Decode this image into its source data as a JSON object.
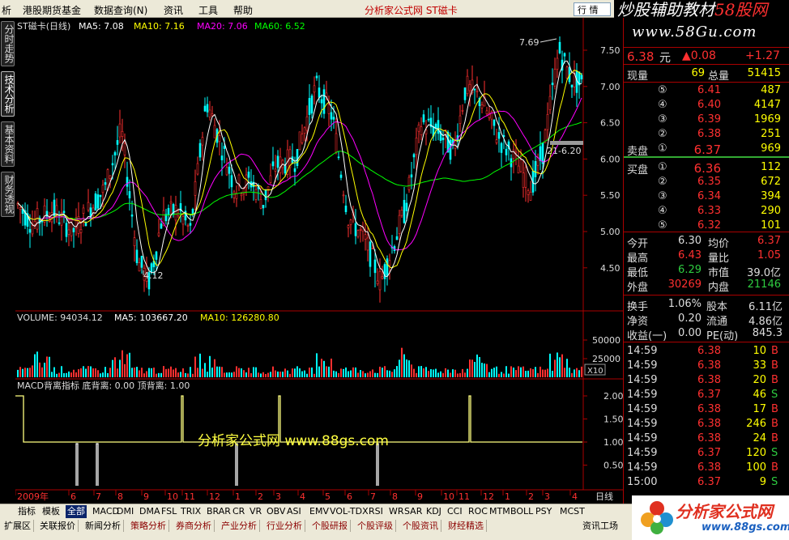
{
  "menu": {
    "items": [
      "析",
      "港股期货基金",
      "数据查询(N)",
      "资讯",
      "工具",
      "帮助"
    ],
    "window_title": "分析家公式网 ST磁卡",
    "right_button": "行 情",
    "top_logo_a": "炒股辅助教材",
    "top_logo_b": "58股网"
  },
  "left_tabs": [
    "分时走势",
    "技术分析",
    "基本资料",
    "财务透视"
  ],
  "kline": {
    "header_name": "ST磁卡(日线)",
    "ma5": "MA5: 7.08",
    "ma10": "MA10: 7.16",
    "ma20": "MA20: 7.06",
    "ma60": "MA60: 6.52",
    "ticks": [
      "7.50",
      "7.00",
      "6.50",
      "6.00",
      "5.50",
      "5.00",
      "4.50"
    ],
    "high_label": "7.69",
    "low_label": "4.12",
    "mark_label": "21-6.20",
    "colors": {
      "ma5": "#ffffff",
      "ma10": "#ffff00",
      "ma20": "#ff00ff",
      "ma60": "#00ff00",
      "up": "#ff3030",
      "down": "#00ffff"
    }
  },
  "volume": {
    "header": "VOLUME: 94034.12",
    "ma5": "MA5: 103667.20",
    "ma10": "MA10: 126280.80",
    "ticks": [
      "50000",
      "25000"
    ],
    "unit": "X10"
  },
  "macd": {
    "header": "MACD背离指标  底背离: 0.00  顶背离: 1.00",
    "ticks": [
      "2.00",
      "1.50",
      "1.00",
      "0.50"
    ],
    "watermark": "分析家公式网 www.88gs.com"
  },
  "date_axis": {
    "labels": [
      "2009年",
      "6",
      "7",
      "8",
      "9",
      "10",
      "11",
      "12",
      "1",
      "2",
      "3",
      "4",
      "5",
      "6",
      "7",
      "8",
      "9",
      "10",
      "11",
      "12",
      "1",
      "2",
      "3",
      "4"
    ],
    "period": "日线"
  },
  "quote": {
    "logo": "www.58Gu.com",
    "price": "6.38",
    "price_unit": "元",
    "change": "▲0.08",
    "change_pct": "+1.27",
    "cur_vol_label": "现量",
    "cur_vol": "69",
    "total_vol_label": "总量",
    "total_vol": "51415",
    "sell_label": "卖盘",
    "buy_label": "买盘",
    "sells": [
      {
        "idx": "⑤",
        "price": "6.41",
        "vol": "487"
      },
      {
        "idx": "④",
        "price": "6.40",
        "vol": "4147"
      },
      {
        "idx": "③",
        "price": "6.39",
        "vol": "1969"
      },
      {
        "idx": "②",
        "price": "6.38",
        "vol": "251"
      },
      {
        "idx": "①",
        "price": "6.37",
        "vol": "969"
      }
    ],
    "buys": [
      {
        "idx": "①",
        "price": "6.36",
        "vol": "112"
      },
      {
        "idx": "②",
        "price": "6.35",
        "vol": "672"
      },
      {
        "idx": "③",
        "price": "6.34",
        "vol": "394"
      },
      {
        "idx": "④",
        "price": "6.33",
        "vol": "290"
      },
      {
        "idx": "⑤",
        "price": "6.32",
        "vol": "101"
      }
    ],
    "stats": [
      {
        "l1": "今开",
        "v1": "6.30",
        "c1": "wht",
        "l2": "均价",
        "v2": "6.37",
        "c2": "red"
      },
      {
        "l1": "最高",
        "v1": "6.43",
        "c1": "red",
        "l2": "量比",
        "v2": "1.05",
        "c2": "red"
      },
      {
        "l1": "最低",
        "v1": "6.29",
        "c1": "grn",
        "l2": "市值",
        "v2": "39.0亿",
        "c2": "wht"
      },
      {
        "l1": "外盘",
        "v1": "30269",
        "c1": "red",
        "l2": "内盘",
        "v2": "21146",
        "c2": "grn"
      }
    ],
    "stats2": [
      {
        "l1": "换手",
        "v1": "1.06%",
        "l2": "股本",
        "v2": "6.11亿"
      },
      {
        "l1": "净资",
        "v1": "0.20",
        "l2": "流通",
        "v2": "4.86亿"
      },
      {
        "l1": "收益(一)",
        "v1": "0.00",
        "l2": "PE(动)",
        "v2": "845.3"
      }
    ],
    "ticks_list": [
      {
        "t": "14:59",
        "p": "6.38",
        "pc": "red",
        "v": "10",
        "s": "B",
        "sc": "red"
      },
      {
        "t": "14:59",
        "p": "6.38",
        "pc": "red",
        "v": "33",
        "s": "B",
        "sc": "red"
      },
      {
        "t": "14:59",
        "p": "6.38",
        "pc": "red",
        "v": "20",
        "s": "B",
        "sc": "red"
      },
      {
        "t": "14:59",
        "p": "6.37",
        "pc": "red",
        "v": "46",
        "s": "S",
        "sc": "grn"
      },
      {
        "t": "14:59",
        "p": "6.38",
        "pc": "red",
        "v": "17",
        "s": "B",
        "sc": "red"
      },
      {
        "t": "14:59",
        "p": "6.38",
        "pc": "red",
        "v": "246",
        "s": "B",
        "sc": "red"
      },
      {
        "t": "14:59",
        "p": "6.38",
        "pc": "red",
        "v": "24",
        "s": "B",
        "sc": "red"
      },
      {
        "t": "14:59",
        "p": "6.37",
        "pc": "red",
        "v": "120",
        "s": "S",
        "sc": "grn"
      },
      {
        "t": "14:59",
        "p": "6.38",
        "pc": "red",
        "v": "100",
        "s": "B",
        "sc": "red"
      },
      {
        "t": "15:00",
        "p": "6.37",
        "pc": "red",
        "v": "9",
        "s": "S",
        "sc": "grn"
      }
    ]
  },
  "indicator_tabs": [
    "指标",
    "模板",
    "全部",
    "MACD",
    "DMI",
    "DMA",
    "FSL",
    "TRIX",
    "BRAR",
    "CR",
    "VR",
    "OBV",
    "ASI",
    "EMV",
    "VOL-TDX",
    "RSI",
    "WR",
    "SAR",
    "KDJ",
    "CCI",
    "ROC",
    "MTM",
    "BOLL",
    "PSY",
    "MCST"
  ],
  "bottom_tabs": [
    "扩展区",
    "关联报价",
    "新闻分析",
    "策略分析",
    "券商分析",
    "产业分析",
    "行业分析",
    "个股研报",
    "个股评级",
    "个股资讯",
    "财经精选"
  ],
  "bottom_right": "资讯工场",
  "corner_logo": {
    "big": "分析家公式网",
    "small": "www.88gs.com"
  }
}
